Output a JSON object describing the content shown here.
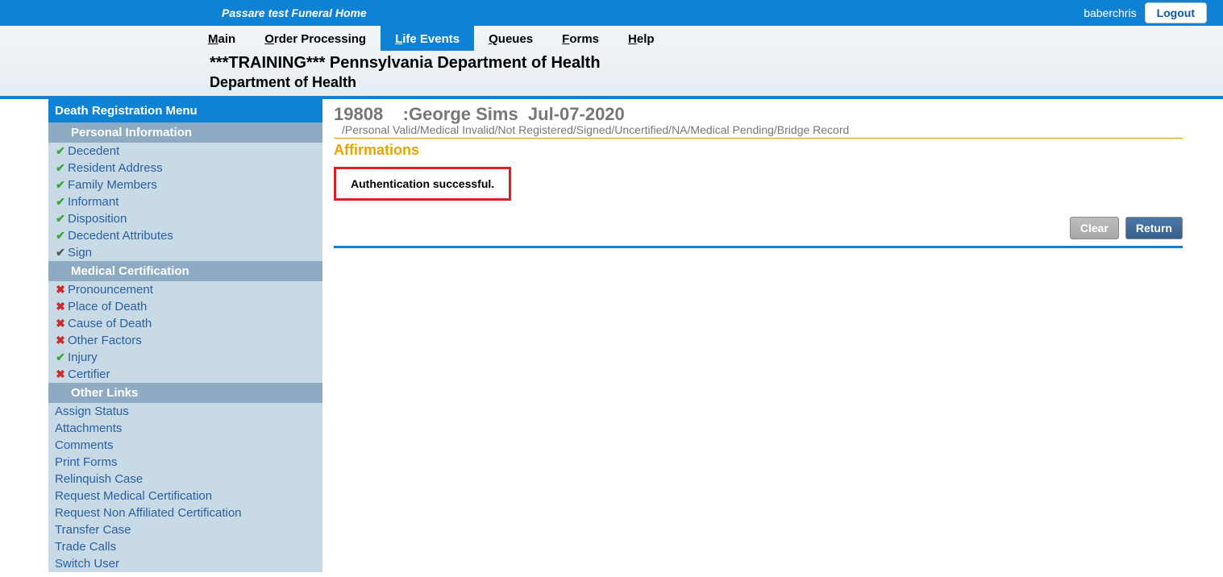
{
  "topbar": {
    "homeName": "Passare test Funeral Home",
    "username": "baberchris",
    "logout": "Logout"
  },
  "menu": {
    "items": [
      "Main",
      "Order Processing",
      "Life Events",
      "Queues",
      "Forms",
      "Help"
    ],
    "activeIndex": 2
  },
  "training": {
    "line1": "***TRAINING*** Pennsylvania Department of Health",
    "line2": "Department of Health"
  },
  "sidebar": {
    "title": "Death Registration Menu",
    "sections": [
      {
        "header": "Personal Information",
        "items": [
          {
            "status": "check",
            "label": "Decedent"
          },
          {
            "status": "check",
            "label": "Resident Address"
          },
          {
            "status": "check",
            "label": "Family Members"
          },
          {
            "status": "check",
            "label": "Informant"
          },
          {
            "status": "check",
            "label": "Disposition"
          },
          {
            "status": "check",
            "label": "Decedent Attributes"
          },
          {
            "status": "neutral",
            "label": "Sign"
          }
        ]
      },
      {
        "header": "Medical Certification",
        "items": [
          {
            "status": "cross",
            "label": "Pronouncement"
          },
          {
            "status": "cross",
            "label": "Place of Death"
          },
          {
            "status": "cross",
            "label": "Cause of Death"
          },
          {
            "status": "cross",
            "label": "Other Factors"
          },
          {
            "status": "check",
            "label": "Injury"
          },
          {
            "status": "cross",
            "label": "Certifier"
          }
        ]
      },
      {
        "header": "Other Links",
        "items": [
          {
            "status": "",
            "label": "Assign Status"
          },
          {
            "status": "",
            "label": "Attachments"
          },
          {
            "status": "",
            "label": "Comments"
          },
          {
            "status": "",
            "label": "Print Forms"
          },
          {
            "status": "",
            "label": "Relinquish Case"
          },
          {
            "status": "",
            "label": "Request Medical Certification"
          },
          {
            "status": "",
            "label": "Request Non Affiliated Certification"
          },
          {
            "status": "",
            "label": "Transfer Case"
          },
          {
            "status": "",
            "label": "Trade Calls"
          },
          {
            "status": "",
            "label": "Switch User"
          }
        ]
      }
    ]
  },
  "content": {
    "caseId": "19808",
    "caseName": ":George Sims",
    "caseDate": "Jul-07-2020",
    "statusPath": "/Personal Valid/Medical Invalid/Not Registered/Signed/Uncertified/NA/Medical Pending/Bridge Record",
    "sectionTitle": "Affirmations",
    "message": "Authentication successful.",
    "buttons": {
      "clear": "Clear",
      "return": "Return"
    }
  }
}
